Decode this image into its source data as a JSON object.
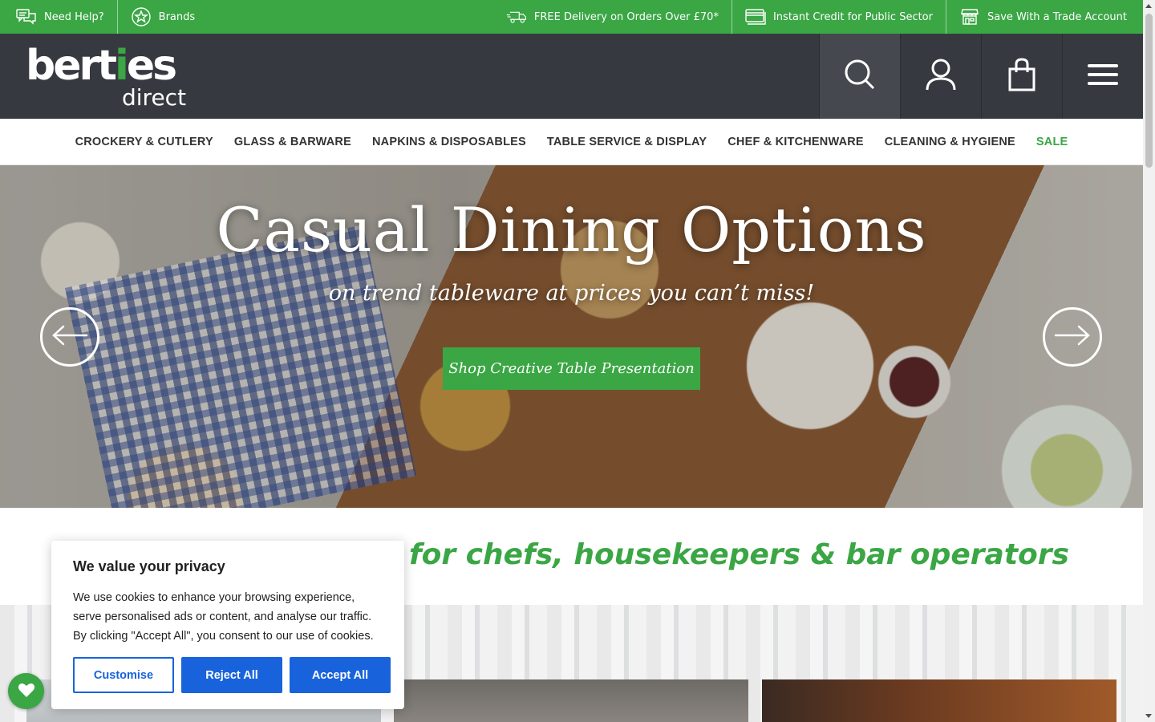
{
  "topbar": {
    "need_help": "Need Help?",
    "brands": "Brands",
    "free_delivery": "FREE Delivery on Orders Over £70*",
    "instant_credit": "Instant Credit for Public Sector",
    "trade_account": "Save With a Trade Account"
  },
  "logo": {
    "main_before": "bert",
    "main_i": "i",
    "main_after": "es",
    "sub": "direct"
  },
  "nav": {
    "items": [
      "CROCKERY & CUTLERY",
      "GLASS & BARWARE",
      "NAPKINS & DISPOSABLES",
      "TABLE SERVICE & DISPLAY",
      "CHEF & KITCHENWARE",
      "CLEANING & HYGIENE"
    ],
    "sale": "SALE"
  },
  "hero": {
    "title": "Casual Dining Options",
    "subtitle": "on trend tableware at prices you can’t miss!",
    "cta": "Shop Creative Table Presentation"
  },
  "tagline": "for chefs, housekeepers & bar operators",
  "cookie": {
    "title": "We value your privacy",
    "body": "We use cookies to enhance your browsing experience, serve personalised ads or content, and analyse our traffic. By clicking \"Accept All\", you consent to our use of cookies.",
    "customise": "Customise",
    "reject": "Reject All",
    "accept": "Accept All"
  },
  "colors": {
    "brand_green": "#3aa644",
    "header_dark": "#363a40",
    "cookie_blue": "#1863dc"
  },
  "icons": [
    "chat-icon",
    "star-icon",
    "truck-icon",
    "credit-card-icon",
    "store-icon",
    "search-icon",
    "user-icon",
    "shopping-bag-icon",
    "menu-icon",
    "arrow-left-icon",
    "arrow-right-icon",
    "heart-icon"
  ]
}
